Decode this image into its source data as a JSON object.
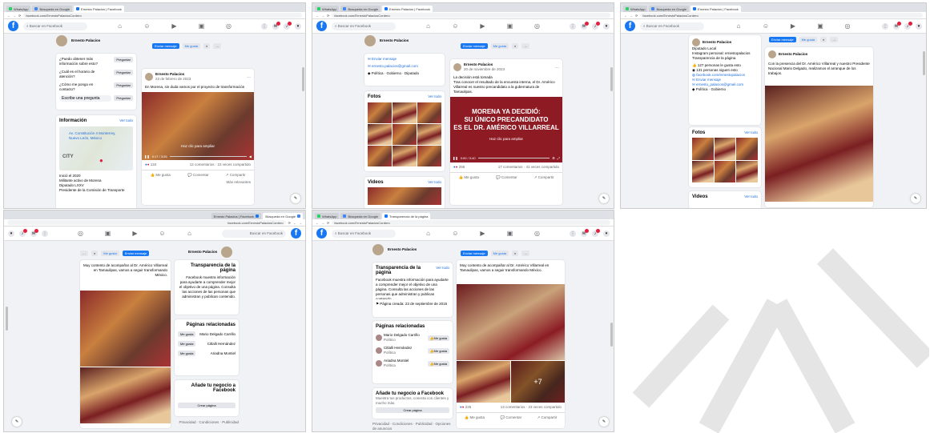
{
  "tabs": {
    "whatsapp": "WhatsApp",
    "fb_tab_1": "Ernesto Palacios | Facebook",
    "fb_tab_2": "Ernesto Palacios | Facebook",
    "fb_tab_3": "Ernesto Palacios | Facebook",
    "search_tab": "Búsqueda en Google",
    "transparency_tab": "Transparencia de la página"
  },
  "url": "facebook.com/ErnestoPalaciosCordero",
  "search": {
    "placeholder": "Buscar en Facebook"
  },
  "page": {
    "name": "Ernesto Palacios",
    "verified": "✓",
    "send_message": "Enviar mensaje",
    "like": "Me gusta",
    "follow": "Seguir"
  },
  "questions": {
    "q1": "¿Puedo obtener más información sobre esto?",
    "q2": "¿Cuál es el horario de atención?",
    "q3": "¿Cómo me pongo en contacto?",
    "ask_label": "Preguntar",
    "custom": "Escribe una pregunta"
  },
  "info": {
    "title": "Información",
    "see_all": "Ver todo",
    "address": "Av. Constitución 4 Monterrey, Nuevo León, México",
    "map_label": "CITY",
    "bio_1": "Inició el 2020",
    "bio_2": "Militante activo de Morena",
    "bio_3": "Diputado LXXV",
    "bio_4": "Presidente de la Comisión de Transporte"
  },
  "post1": {
    "author": "Ernesto Palacios",
    "time": "23 de febrero de 2023",
    "text": "En Morena, sin duda vamos por el proyecto de transformación",
    "play_label": "Haz clic para ampliar",
    "time_code": "0:17 / 3:26",
    "reactions": "134",
    "comments": "12 comentarios · 23 veces compartido",
    "like_btn": "Me gusta",
    "comment_btn": "Comentar",
    "share_btn": "Compartir",
    "relevant": "Más relevantes"
  },
  "post2": {
    "author": "Ernesto Palacios",
    "time": "20 de noviembre de 2023",
    "text_1": "La decisión está tomada",
    "text_2": "Tras conocer el resultado de la encuesta interna, el Dr. Américo Villarreal es nuestro precandidato a la gubernatura de Tamaulipas.",
    "banner_1": "MORENA YA DECIDIÓ:",
    "banner_2": "SU ÚNICO PRECANDIDATO",
    "banner_3": "ES EL DR. AMÉRICO VILLARREAL",
    "play_label": "Haz clic para ampliar",
    "time_code": "0:00 / 0:40",
    "reactions": "256",
    "comments": "17 comentarios · 41 veces compartido",
    "like_btn": "Me gusta",
    "comment_btn": "Comentar",
    "share_btn": "Compartir"
  },
  "sidebar2": {
    "item1": "Enviar mensaje",
    "item2": "ernesto.palacios@gmail.com",
    "item3": "Política · Gobierno · Diputado",
    "photos": "Fotos",
    "see_all": "Ver todo",
    "videos": "Videos"
  },
  "sidebar3": {
    "about_1": "Diputado Local",
    "about_2": "Instagram personal: ernestopalacios",
    "about_3": "Transparencia de la página",
    "item_1": "127 personas le gusta esto",
    "item_2": "131 personas siguen esto",
    "item_3": "facebook.com/ernestopalacios",
    "item_4": "Enviar mensaje",
    "item_5": "ernesto_palacios@gmail.com",
    "item_6": "Política · Gobierno",
    "photos": "Fotos",
    "videos": "Videos",
    "see_all": "Ver todo",
    "post_text": "Con la presencia del Dr. Américo Villarreal y nuestro Presidente Nacional Mario Delgado, realizamos el arranque de los trabajos."
  },
  "transparency": {
    "title": "Transparencia de la página",
    "see_all": "Ver todo",
    "desc": "Facebook muestra información para ayudarte a comprender mejor el objetivo de una página. Consulta las acciones de las personas que administran y publican contenido.",
    "created": "Página creada: 23 de septiembre de 2015",
    "related": "Páginas relacionadas",
    "rel_1": "Mario Delgado Carrillo",
    "rel_1_sub": "Político",
    "rel_2": "Citlalli Hernández",
    "rel_2_sub": "Política",
    "rel_3": "Ariadna Montiel",
    "rel_3_sub": "Política",
    "like_btn": "Me gusta",
    "business_title": "Añade tu negocio a Facebook",
    "business_desc": "Muestra tus productos, conecta con clientes y mucho más.",
    "create_page": "Crear página",
    "footer": "Privacidad · Condiciones · Publicidad · Opciones de anuncios",
    "post_text": "Muy contento de acompañar al Dr. Américo Villarreal en Tamaulipas, vamos a seguir transformando México.",
    "reactions": "226",
    "comments": "13 comentarios · 23 veces compartido"
  },
  "mirror": {
    "title": "Transparencia de la página",
    "related": "Páginas relacionadas",
    "business_title": "Añade tu negocio a Facebook",
    "create_page": "Crear página",
    "footer": "Privacidad · Condiciones · Publicidad"
  },
  "watermark": "OLTA"
}
